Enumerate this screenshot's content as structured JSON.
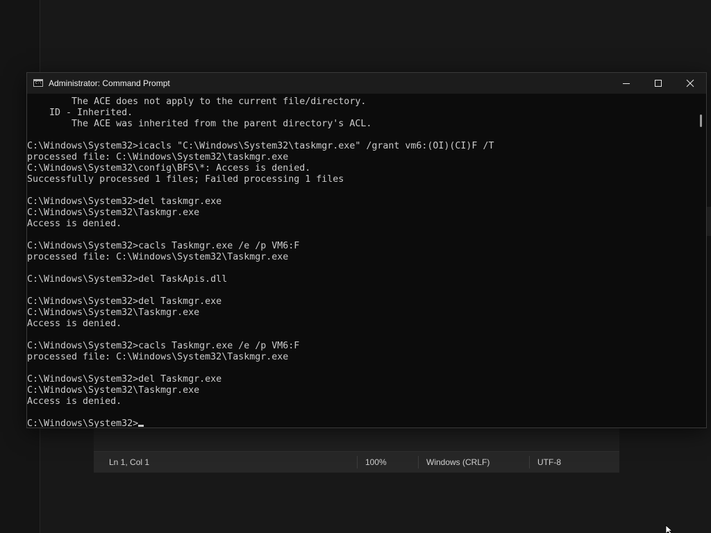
{
  "window": {
    "title": "Administrator: Command Prompt",
    "minimize_glyph": "—",
    "maximize_glyph": "☐",
    "close_glyph": "✕"
  },
  "console": {
    "lines": [
      "        The ACE does not apply to the current file/directory.",
      "    ID - Inherited.",
      "        The ACE was inherited from the parent directory's ACL.",
      "",
      "C:\\Windows\\System32>icacls \"C:\\Windows\\System32\\taskmgr.exe\" /grant vm6:(OI)(CI)F /T",
      "processed file: C:\\Windows\\System32\\taskmgr.exe",
      "C:\\Windows\\System32\\config\\BFS\\*: Access is denied.",
      "Successfully processed 1 files; Failed processing 1 files",
      "",
      "C:\\Windows\\System32>del taskmgr.exe",
      "C:\\Windows\\System32\\Taskmgr.exe",
      "Access is denied.",
      "",
      "C:\\Windows\\System32>cacls Taskmgr.exe /e /p VM6:F",
      "processed file: C:\\Windows\\System32\\Taskmgr.exe",
      "",
      "C:\\Windows\\System32>del TaskApis.dll",
      "",
      "C:\\Windows\\System32>del Taskmgr.exe",
      "C:\\Windows\\System32\\Taskmgr.exe",
      "Access is denied.",
      "",
      "C:\\Windows\\System32>cacls Taskmgr.exe /e /p VM6:F",
      "processed file: C:\\Windows\\System32\\Taskmgr.exe",
      "",
      "C:\\Windows\\System32>del Taskmgr.exe",
      "C:\\Windows\\System32\\Taskmgr.exe",
      "Access is denied.",
      ""
    ],
    "prompt": "C:\\Windows\\System32>"
  },
  "background_editor": {
    "status": {
      "position": "Ln 1, Col 1",
      "zoom": "100%",
      "line_ending": "Windows (CRLF)",
      "encoding": "UTF-8"
    }
  },
  "colors": {
    "console_bg": "#0c0c0c",
    "console_fg": "#cccccc",
    "titlebar_bg": "#1c1c1c"
  },
  "icons": {
    "app": "command-prompt-icon",
    "minimize": "minimize-icon",
    "maximize": "maximize-icon",
    "close": "close-icon",
    "pointer": "mouse-pointer-icon"
  }
}
